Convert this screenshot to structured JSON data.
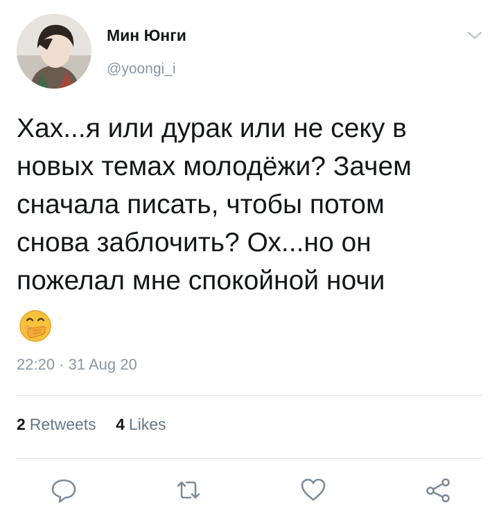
{
  "user": {
    "display_name": "Мин Юнги",
    "handle": "@yoongi_i",
    "avatar_icon": "profile-photo",
    "menu_icon": "chevron-down-icon"
  },
  "tweet": {
    "lines": [
      "Хах...я или дурак или не секу в",
      "новых темах молодёжи? Зачем",
      "сначала писать, чтобы потом",
      "снова заблочить? Ох...но он",
      "пожелал мне спокойной ночи"
    ],
    "emoji": "face-with-hand-over-mouth",
    "timestamp": "22:20 · 31 Aug 20"
  },
  "stats": {
    "retweets_count": "2",
    "retweets_label": "Retweets",
    "likes_count": "4",
    "likes_label": "Likes"
  },
  "actions": [
    {
      "name": "reply",
      "icon": "speech-bubble-icon"
    },
    {
      "name": "retweet",
      "icon": "retweet-icon"
    },
    {
      "name": "like",
      "icon": "heart-icon"
    },
    {
      "name": "share",
      "icon": "share-icon"
    }
  ],
  "colors": {
    "text": "#14171a",
    "secondary": "#8a96a3",
    "stat_label": "#657786",
    "divider": "#e1e8ed",
    "icon": "#7d8b99"
  }
}
